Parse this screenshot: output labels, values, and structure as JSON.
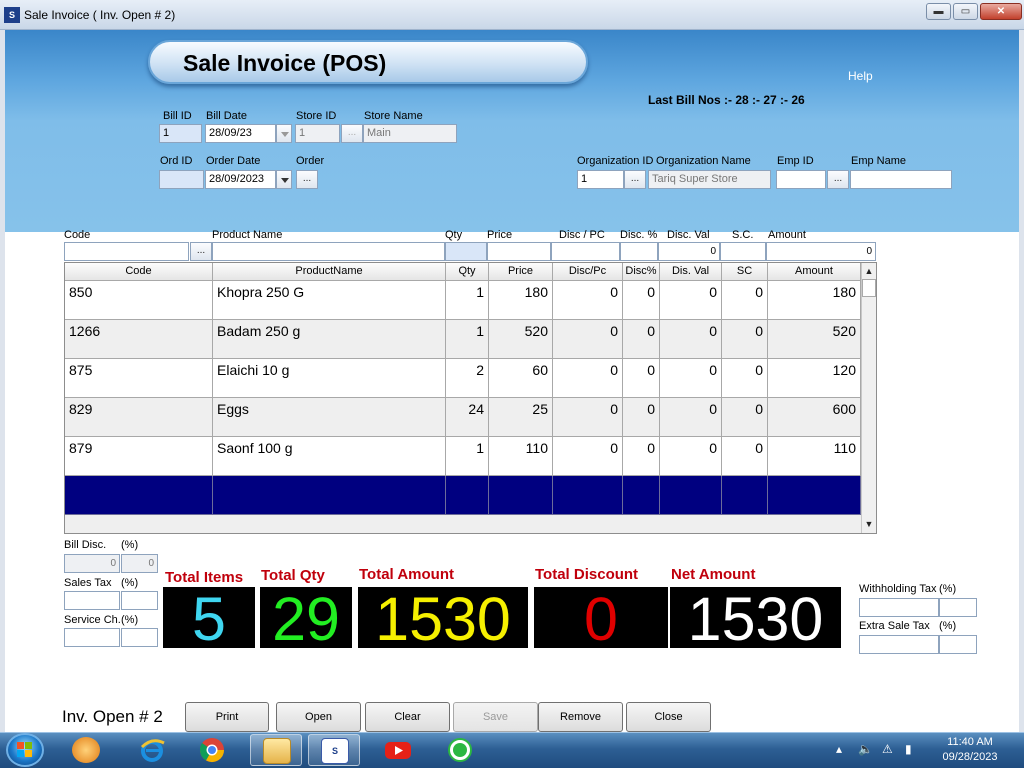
{
  "window": {
    "title": "Sale Invoice ( Inv. Open # 2)",
    "min_glyph": "▬",
    "max_glyph": "▭",
    "close_glyph": "✕"
  },
  "header": {
    "title": "Sale Invoice (POS)",
    "help": "Help",
    "last_bill": "Last Bill Nos :- 28 :- 27 :- 26"
  },
  "bill": {
    "bill_id_label": "Bill ID",
    "bill_id": "1",
    "bill_date_label": "Bill Date",
    "bill_date": "28/09/23",
    "store_id_label": "Store ID",
    "store_id": "1",
    "store_name_label": "Store Name",
    "store_name": "Main",
    "ord_id_label": "Ord ID",
    "ord_id": "",
    "order_date_label": "Order Date",
    "order_date": "28/09/2023",
    "order_label": "Order",
    "org_id_label": "Organization ID",
    "org_id": "1",
    "org_name_label": "Organization Name",
    "org_name": "Tariq Super Store",
    "emp_id_label": "Emp ID",
    "emp_id": "",
    "emp_name_label": "Emp Name",
    "emp_name": "",
    "dots": "..."
  },
  "entry": {
    "labels": {
      "code": "Code",
      "product": "Product Name",
      "qty": "Qty",
      "price": "Price",
      "disc_pc": "Disc / PC",
      "disc_pct": "Disc. %",
      "disc_val": "Disc. Val",
      "sc": "S.C.",
      "amount": "Amount"
    },
    "disc_val": "0",
    "amount": "0"
  },
  "grid": {
    "columns": [
      "Code",
      "ProductName",
      "Qty",
      "Price",
      "Disc/Pc",
      "Disc%",
      "Dis. Val",
      "SC",
      "Amount"
    ],
    "rows": [
      {
        "code": "850",
        "name": "Khopra 250 G",
        "qty": "1",
        "price": "180",
        "disc_pc": "0",
        "disc_pct": "0",
        "dis_val": "0",
        "sc": "0",
        "amount": "180"
      },
      {
        "code": "1266",
        "name": "Badam 250 g",
        "qty": "1",
        "price": "520",
        "disc_pc": "0",
        "disc_pct": "0",
        "dis_val": "0",
        "sc": "0",
        "amount": "520"
      },
      {
        "code": "875",
        "name": "Elaichi 10 g",
        "qty": "2",
        "price": "60",
        "disc_pc": "0",
        "disc_pct": "0",
        "dis_val": "0",
        "sc": "0",
        "amount": "120"
      },
      {
        "code": "829",
        "name": "Eggs",
        "qty": "24",
        "price": "25",
        "disc_pc": "0",
        "disc_pct": "0",
        "dis_val": "0",
        "sc": "0",
        "amount": "600"
      },
      {
        "code": "879",
        "name": "Saonf 100 g",
        "qty": "1",
        "price": "110",
        "disc_pc": "0",
        "disc_pct": "0",
        "dis_val": "0",
        "sc": "0",
        "amount": "110"
      }
    ],
    "scroll_up": "▲",
    "scroll_down": "▼"
  },
  "extras": {
    "bill_disc_label": "Bill Disc.",
    "pct": "(%)",
    "bill_disc": "0",
    "bill_disc_pct": "0",
    "sales_tax_label": "Sales Tax",
    "service_label": "Service Ch.",
    "withholding_label": "Withholding Tax",
    "extra_sale_tax_label": "Extra Sale Tax"
  },
  "totals": {
    "items_label": "Total Items",
    "items": "5",
    "qty_label": "Total Qty",
    "qty": "29",
    "amount_label": "Total Amount",
    "amount": "1530",
    "discount_label": "Total Discount",
    "discount": "0",
    "net_label": "Net Amount",
    "net": "1530",
    "colors": {
      "items": "#3fd6f0",
      "qty": "#22ee22",
      "amount": "#f6f000",
      "discount": "#e00000",
      "net": "#ffffff",
      "label": "#c0000c"
    }
  },
  "footer": {
    "inv_open": "Inv. Open # 2",
    "buttons": {
      "print": "Print",
      "open": "Open",
      "clear": "Clear",
      "save": "Save",
      "remove": "Remove",
      "close": "Close"
    }
  },
  "taskbar": {
    "apps": [
      "windows-media-player",
      "internet-explorer",
      "chrome",
      "file-explorer",
      "softown-pos",
      "youtube",
      "whatsapp"
    ],
    "time": "11:40 AM",
    "date": "09/28/2023"
  }
}
